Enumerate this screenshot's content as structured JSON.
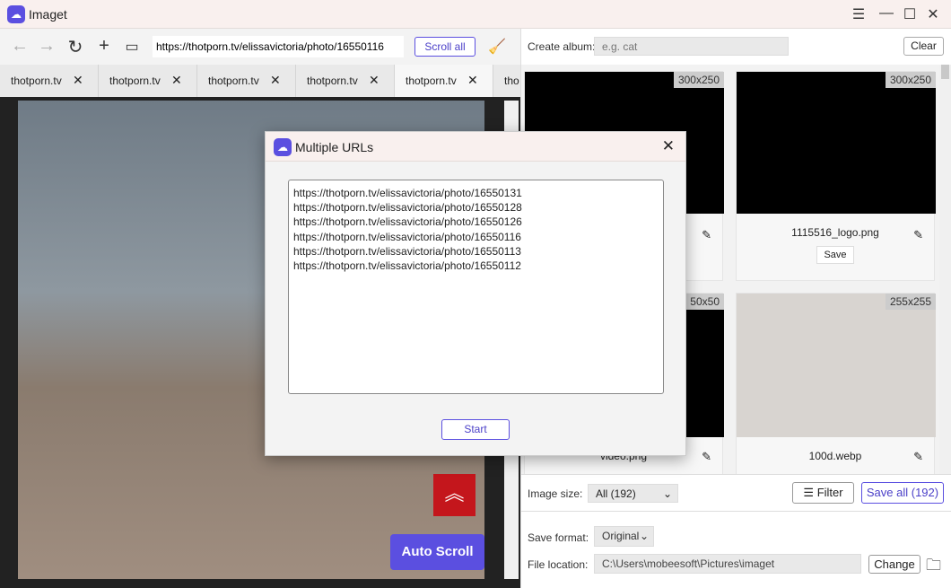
{
  "app": {
    "title": "Imaget"
  },
  "toolbar": {
    "url": "https://thotporn.tv/elissavictoria/photo/16550116",
    "scroll_all": "Scroll all"
  },
  "tabs": [
    {
      "label": "thotporn.tv"
    },
    {
      "label": "thotporn.tv"
    },
    {
      "label": "thotporn.tv"
    },
    {
      "label": "thotporn.tv"
    },
    {
      "label": "thotporn.tv",
      "active": true
    },
    {
      "label": "tho"
    }
  ],
  "page": {
    "auto_scroll": "Auto Scroll"
  },
  "album": {
    "label": "Create album:",
    "placeholder": "e.g. cat",
    "clear": "Clear"
  },
  "cards": [
    {
      "size": "300x250",
      "name": ""
    },
    {
      "size": "300x250",
      "name": "1115516_logo.png",
      "save": "Save"
    },
    {
      "size": "50x50",
      "name": "video.png"
    },
    {
      "size": "255x255",
      "name": "100d.webp"
    }
  ],
  "filters": {
    "image_size_label": "Image size:",
    "image_size_value": "All (192)",
    "filter": "Filter",
    "save_all": "Save all (192)"
  },
  "save": {
    "format_label": "Save format:",
    "format_value": "Original",
    "location_label": "File location:",
    "location_value": "C:\\Users\\mobeesoft\\Pictures\\imaget",
    "change": "Change"
  },
  "dialog": {
    "title": "Multiple URLs",
    "urls": "https://thotporn.tv/elissavictoria/photo/16550131\nhttps://thotporn.tv/elissavictoria/photo/16550128\nhttps://thotporn.tv/elissavictoria/photo/16550126\nhttps://thotporn.tv/elissavictoria/photo/16550116\nhttps://thotporn.tv/elissavictoria/photo/16550113\nhttps://thotporn.tv/elissavictoria/photo/16550112",
    "start": "Start"
  },
  "colors": {
    "accent": "#5b4fe0",
    "scroll_top": "#c4161c"
  }
}
